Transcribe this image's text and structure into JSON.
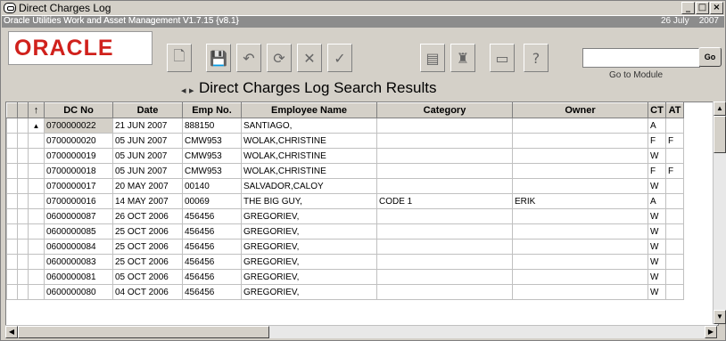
{
  "window": {
    "title": "Direct Charges Log",
    "subtitle": "Oracle Utilities Work and Asset Management V1.7.15 {v8.1}",
    "date": "26 July",
    "year": "2007"
  },
  "logo": "ORACLE",
  "page_title": "Direct Charges Log Search Results",
  "module": {
    "placeholder": "",
    "label": "Go to Module",
    "go_label": "Go"
  },
  "toolbar_icons": [
    "new-doc-icon",
    "save-icon",
    "undo-icon",
    "refresh-icon",
    "delete-icon",
    "spell-check-icon",
    "report-icon",
    "workflow-icon",
    "print-icon",
    "help-icon"
  ],
  "table": {
    "sort_marker": "↑",
    "columns": [
      "DC No",
      "Date",
      "Emp No.",
      "Employee Name",
      "Category",
      "Owner",
      "CT",
      "AT"
    ],
    "rows": [
      [
        "0700000022",
        "21 JUN 2007",
        "888150",
        "SANTIAGO,",
        "",
        "",
        "A",
        ""
      ],
      [
        "0700000020",
        "05 JUN 2007",
        "CMW953",
        "WOLAK,CHRISTINE",
        "",
        "",
        "F",
        "F"
      ],
      [
        "0700000019",
        "05 JUN 2007",
        "CMW953",
        "WOLAK,CHRISTINE",
        "",
        "",
        "W",
        ""
      ],
      [
        "0700000018",
        "05 JUN 2007",
        "CMW953",
        "WOLAK,CHRISTINE",
        "",
        "",
        "F",
        "F"
      ],
      [
        "0700000017",
        "20 MAY 2007",
        "00140",
        "SALVADOR,CALOY",
        "",
        "",
        "W",
        ""
      ],
      [
        "0700000016",
        "14 MAY 2007",
        "00069",
        "THE BIG GUY,",
        "CODE 1",
        "ERIK",
        "A",
        ""
      ],
      [
        "0600000087",
        "26 OCT 2006",
        "456456",
        "GREGORIEV,",
        "",
        "",
        "W",
        ""
      ],
      [
        "0600000085",
        "25 OCT 2006",
        "456456",
        "GREGORIEV,",
        "",
        "",
        "W",
        ""
      ],
      [
        "0600000084",
        "25 OCT 2006",
        "456456",
        "GREGORIEV,",
        "",
        "",
        "W",
        ""
      ],
      [
        "0600000083",
        "25 OCT 2006",
        "456456",
        "GREGORIEV,",
        "",
        "",
        "W",
        ""
      ],
      [
        "0600000081",
        "05 OCT 2006",
        "456456",
        "GREGORIEV,",
        "",
        "",
        "W",
        ""
      ],
      [
        "0600000080",
        "04 OCT 2006",
        "456456",
        "GREGORIEV,",
        "",
        "",
        "W",
        ""
      ]
    ]
  }
}
